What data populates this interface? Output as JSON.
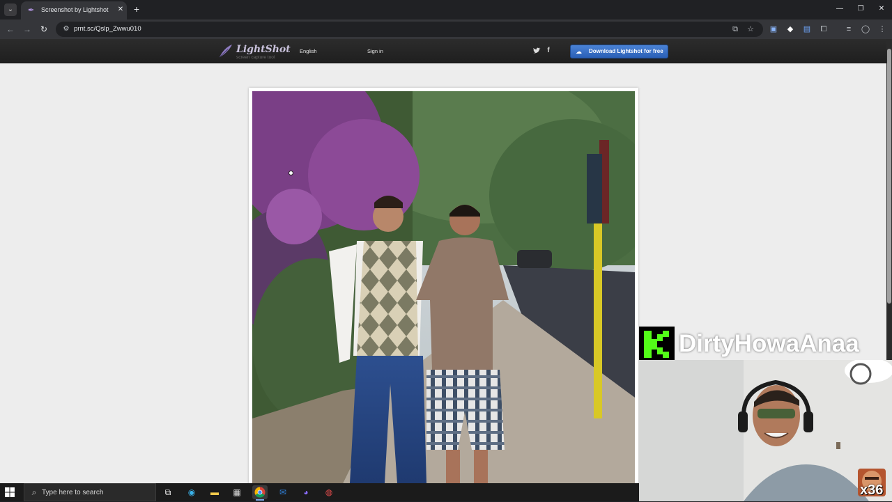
{
  "browser": {
    "tab_title": "Screenshot by Lightshot",
    "tab_close": "✕",
    "new_tab": "+",
    "url": "prnt.sc/Qslp_Zwwu010",
    "window_controls": {
      "minimize": "—",
      "maximize": "❐",
      "close": "✕"
    },
    "nav": {
      "back": "←",
      "forward": "→",
      "reload": "↻"
    }
  },
  "lightshot": {
    "logo_text": "LightShot",
    "tagline": "screen capture tool",
    "language": "English",
    "signin": "Sign in",
    "social": {
      "twitter": "t",
      "facebook": "f"
    },
    "download_label": "Download Lightshot for free"
  },
  "overlay": {
    "streamer_name": "DirtyHowaAnaa",
    "platform_logo": "K",
    "emote_count": "x36"
  },
  "taskbar": {
    "search_placeholder": "Type here to search"
  },
  "colors": {
    "accent_button": "#2a5fb5",
    "kick_green": "#53fc18",
    "page_background": "#ededed"
  }
}
